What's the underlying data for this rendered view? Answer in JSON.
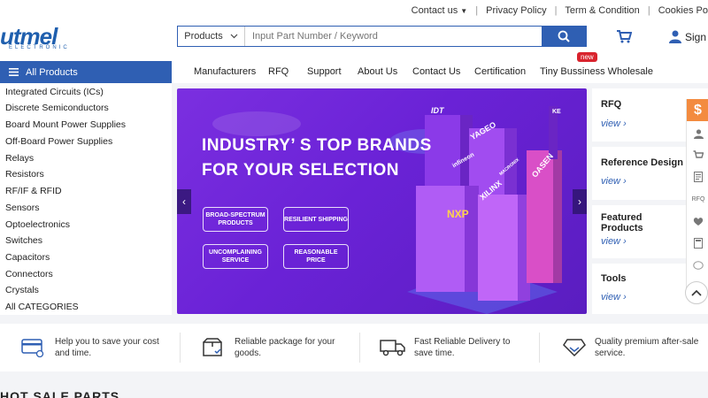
{
  "toplinks": {
    "contact": "Contact us",
    "privacy": "Privacy Policy",
    "terms": "Term & Condition",
    "cookies": "Cookies Po"
  },
  "logo": {
    "text": "utmel",
    "sub": "ELECTRONIC"
  },
  "search": {
    "category": "Products",
    "placeholder": "Input Part Number / Keyword"
  },
  "header": {
    "signin": "Sign"
  },
  "nav": {
    "all_products": "All Products",
    "items": [
      "Manufacturers",
      "RFQ",
      "Support",
      "About Us",
      "Contact Us",
      "Certification",
      "Tiny Bussiness Wholesale"
    ],
    "badge": "new"
  },
  "sidebar": {
    "items": [
      "Integrated Circuits (ICs)",
      "Discrete Semiconductors",
      "Board Mount Power Supplies",
      "Off-Board Power Supplies",
      "Relays",
      "Resistors",
      "RF/IF & RFID",
      "Sensors",
      "Optoelectronics",
      "Switches",
      "Capacitors",
      "Connectors",
      "Crystals",
      "All CATEGORIES"
    ]
  },
  "banner": {
    "title1": "INDUSTRY’ S TOP BRANDS",
    "title2": "FOR YOUR SELECTION",
    "pills": [
      "BROAD-SPECTRUM PRODUCTS",
      "RESILIENT SHIPPING",
      "UNCOMPLAINING SERVICE",
      "REASONABLE PRICE"
    ],
    "brands": [
      "IDT",
      "YAGEO",
      "XILINX",
      "OASEN",
      "NXP",
      "infineon",
      "MACRONIX",
      "KE"
    ],
    "colors": {
      "bg": "#7b2fe0",
      "accent": "#2f5fb3"
    }
  },
  "cards": [
    {
      "title": "RFQ",
      "link": "view"
    },
    {
      "title": "Reference Design",
      "link": "view"
    },
    {
      "title": "Featured Products",
      "link": "view"
    },
    {
      "title": "Tools",
      "link": "view"
    }
  ],
  "floatbar": {
    "dollar": "$",
    "rfq": "RFQ"
  },
  "features": [
    {
      "text": "Help you to save your cost and time.",
      "icon": "credit-card-icon"
    },
    {
      "text": "Reliable package for your goods.",
      "icon": "package-icon"
    },
    {
      "text": "Fast Reliable Delivery to save time.",
      "icon": "truck-icon"
    },
    {
      "text": "Quality premium after-sale service.",
      "icon": "diamond-icon"
    }
  ],
  "section_peek": "HOT SALE PARTS"
}
